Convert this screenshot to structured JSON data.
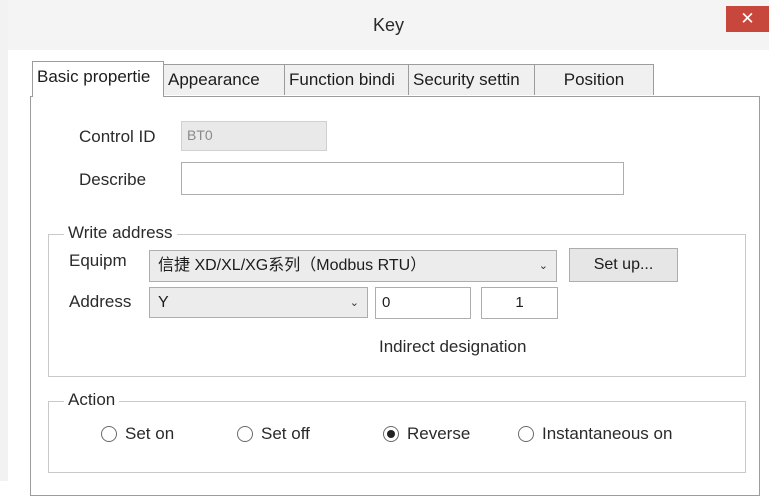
{
  "window": {
    "title": "Key",
    "close_glyph": "✕"
  },
  "tabs": [
    {
      "label": "Basic propertie"
    },
    {
      "label": "Appearance"
    },
    {
      "label": "Function bindi"
    },
    {
      "label": "Security settin"
    },
    {
      "label": "Position"
    }
  ],
  "basic": {
    "control_id_label": "Control ID",
    "control_id_value": "BT0",
    "describe_label": "Describe",
    "describe_value": ""
  },
  "write_address": {
    "group_title": "Write address",
    "equipment_label": "Equipm",
    "equipment_value": "信捷 XD/XL/XG系列（Modbus RTU）",
    "setup_button": "Set up...",
    "address_label": "Address",
    "address_type": "Y",
    "address_value": "0",
    "address_count": "1",
    "indirect_label": "Indirect designation"
  },
  "action": {
    "group_title": "Action",
    "selected": "Reverse",
    "options": [
      {
        "label": "Set on"
      },
      {
        "label": "Set off"
      },
      {
        "label": "Reverse"
      },
      {
        "label": "Instantaneous on"
      }
    ]
  }
}
